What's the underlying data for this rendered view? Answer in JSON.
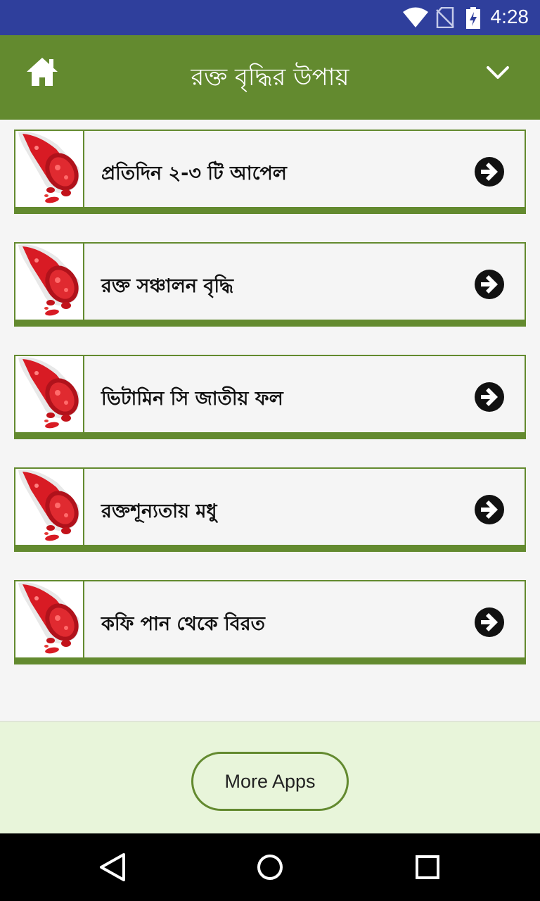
{
  "status_bar": {
    "time": "4:28",
    "icons": [
      "wifi-icon",
      "no-sim-icon",
      "battery-charging-icon"
    ]
  },
  "toolbar": {
    "title": "রক্ত বৃদ্ধির উপায়",
    "home_icon": "home-icon",
    "menu_icon": "chevron-down-icon"
  },
  "list": {
    "items": [
      {
        "label": "প্রতিদিন ২-৩ টি আপেল",
        "thumb_icon": "blood-vessel-icon",
        "action_icon": "arrow-right-circle-icon"
      },
      {
        "label": "রক্ত সঞ্চালন বৃদ্ধি",
        "thumb_icon": "blood-vessel-icon",
        "action_icon": "arrow-right-circle-icon"
      },
      {
        "label": "ভিটামিন সি জাতীয় ফল",
        "thumb_icon": "blood-vessel-icon",
        "action_icon": "arrow-right-circle-icon"
      },
      {
        "label": "রক্তশূন্যতায় মধু",
        "thumb_icon": "blood-vessel-icon",
        "action_icon": "arrow-right-circle-icon"
      },
      {
        "label": "কফি পান থেকে বিরত",
        "thumb_icon": "blood-vessel-icon",
        "action_icon": "arrow-right-circle-icon"
      }
    ]
  },
  "footer": {
    "more_apps_label": "More Apps"
  },
  "nav_bar": {
    "icons": [
      "back-icon",
      "home-circle-icon",
      "recents-icon"
    ]
  },
  "colors": {
    "status_bar": "#2f3f9c",
    "toolbar": "#638a2f",
    "card_border": "#638a2f",
    "footer_bg": "#e8f5da",
    "nav_bar": "#000000"
  }
}
